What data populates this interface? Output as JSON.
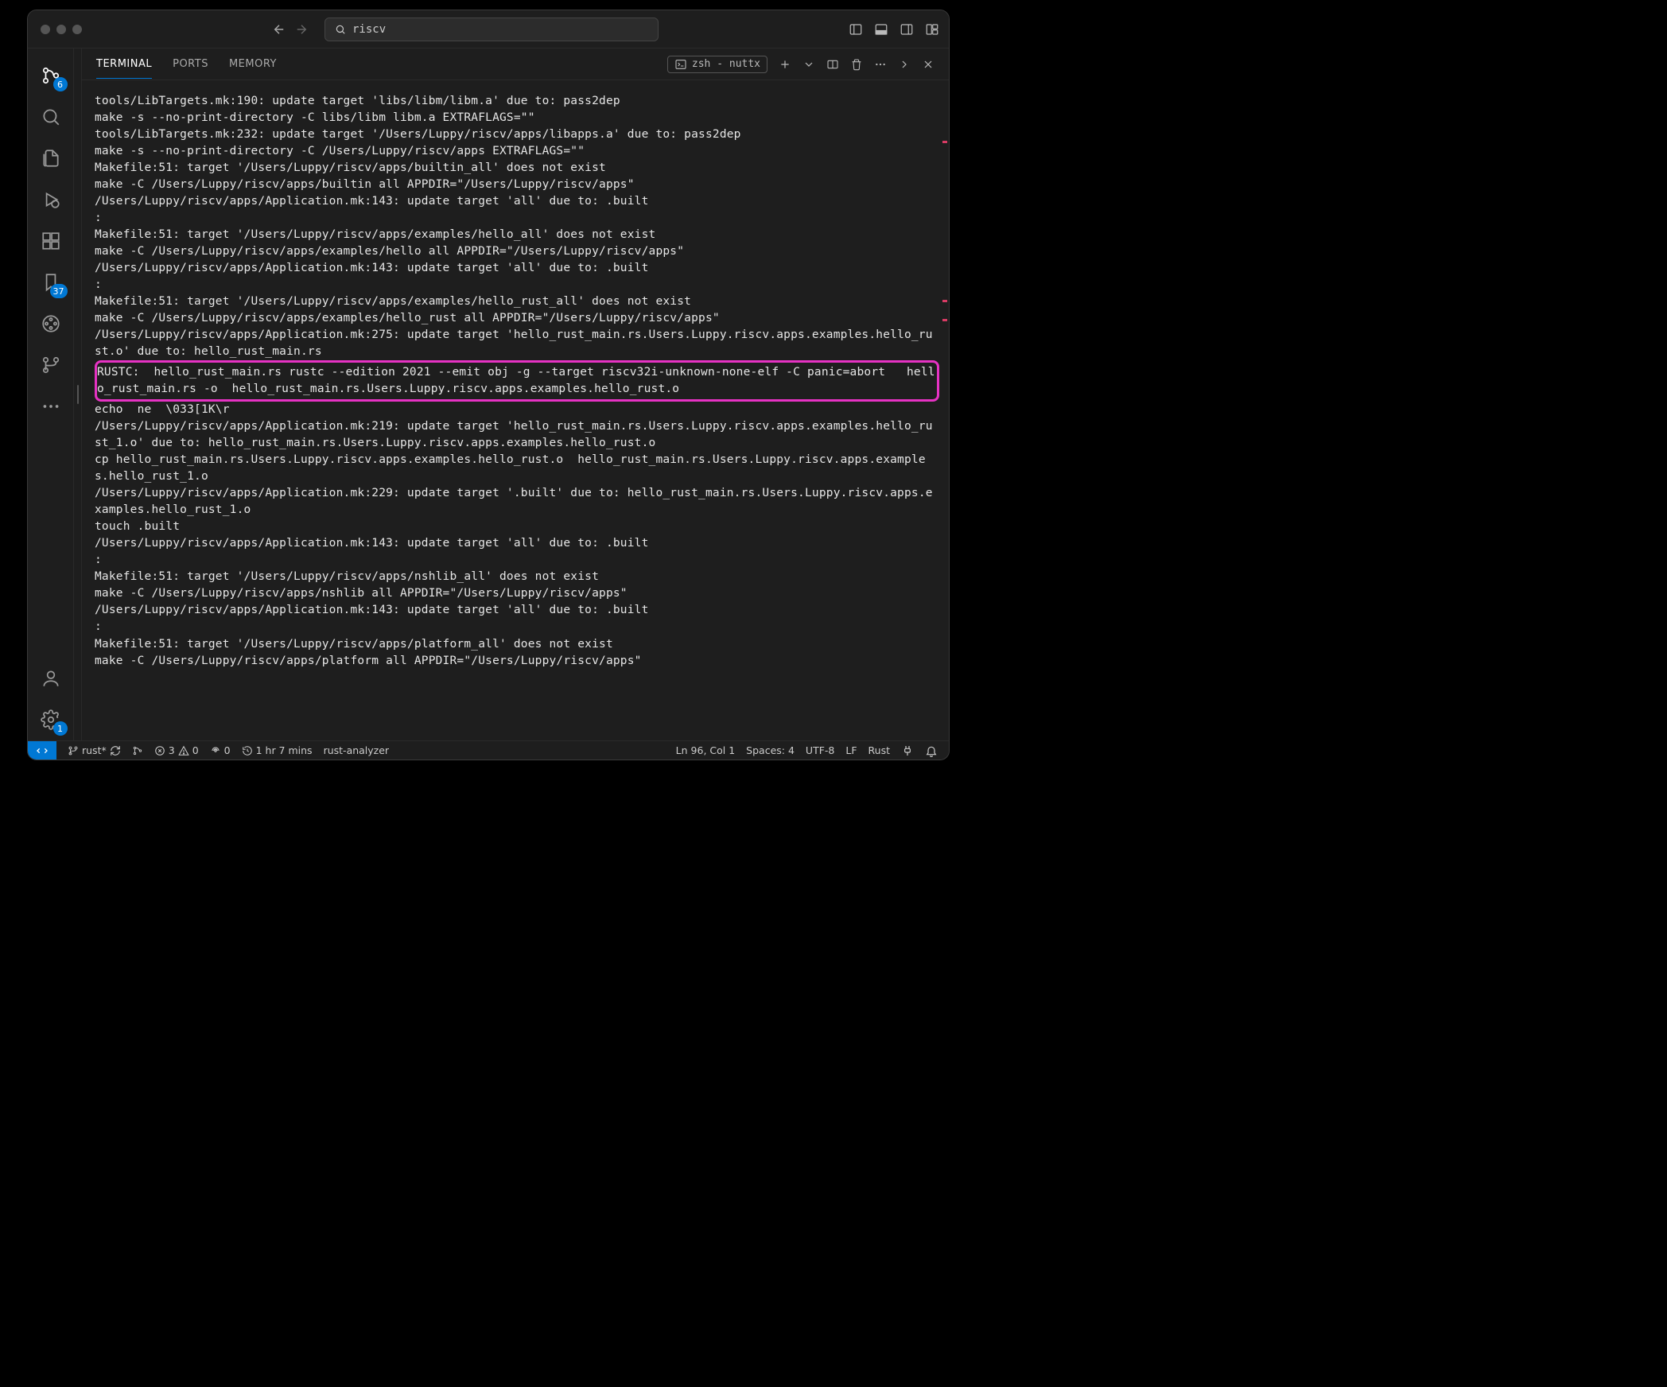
{
  "search": {
    "value": "riscv"
  },
  "activitybar": {
    "scm_badge": "6",
    "files_badge": "37",
    "gear_badge": "1"
  },
  "panel": {
    "tabs": {
      "terminal": "TERMINAL",
      "ports": "PORTS",
      "memory": "MEMORY"
    },
    "term_label": "zsh - nuttx"
  },
  "terminal": {
    "lines_top": [
      "tools/LibTargets.mk:190: update target 'libs/libm/libm.a' due to: pass2dep",
      "make -s --no-print-directory -C libs/libm libm.a EXTRAFLAGS=\"\"",
      "tools/LibTargets.mk:232: update target '/Users/Luppy/riscv/apps/libapps.a' due to: pass2dep",
      "make -s --no-print-directory -C /Users/Luppy/riscv/apps EXTRAFLAGS=\"\"",
      "Makefile:51: target '/Users/Luppy/riscv/apps/builtin_all' does not exist",
      "make -C /Users/Luppy/riscv/apps/builtin all APPDIR=\"/Users/Luppy/riscv/apps\"",
      "/Users/Luppy/riscv/apps/Application.mk:143: update target 'all' due to: .built",
      ":",
      "Makefile:51: target '/Users/Luppy/riscv/apps/examples/hello_all' does not exist",
      "make -C /Users/Luppy/riscv/apps/examples/hello all APPDIR=\"/Users/Luppy/riscv/apps\"",
      "/Users/Luppy/riscv/apps/Application.mk:143: update target 'all' due to: .built",
      ":",
      "Makefile:51: target '/Users/Luppy/riscv/apps/examples/hello_rust_all' does not exist",
      "make -C /Users/Luppy/riscv/apps/examples/hello_rust all APPDIR=\"/Users/Luppy/riscv/apps\"",
      "/Users/Luppy/riscv/apps/Application.mk:275: update target 'hello_rust_main.rs.Users.Luppy.riscv.apps.examples.hello_rust.o' due to: hello_rust_main.rs"
    ],
    "highlight": "RUSTC:  hello_rust_main.rs rustc --edition 2021 --emit obj -g --target riscv32i-unknown-none-elf -C panic=abort   hello_rust_main.rs -o  hello_rust_main.rs.Users.Luppy.riscv.apps.examples.hello_rust.o",
    "lines_bottom": [
      "echo  ne  \\033[1K\\r",
      "/Users/Luppy/riscv/apps/Application.mk:219: update target 'hello_rust_main.rs.Users.Luppy.riscv.apps.examples.hello_rust_1.o' due to: hello_rust_main.rs.Users.Luppy.riscv.apps.examples.hello_rust.o",
      "cp hello_rust_main.rs.Users.Luppy.riscv.apps.examples.hello_rust.o  hello_rust_main.rs.Users.Luppy.riscv.apps.examples.hello_rust_1.o",
      "/Users/Luppy/riscv/apps/Application.mk:229: update target '.built' due to: hello_rust_main.rs.Users.Luppy.riscv.apps.examples.hello_rust_1.o",
      "touch .built",
      "/Users/Luppy/riscv/apps/Application.mk:143: update target 'all' due to: .built",
      ":",
      "Makefile:51: target '/Users/Luppy/riscv/apps/nshlib_all' does not exist",
      "make -C /Users/Luppy/riscv/apps/nshlib all APPDIR=\"/Users/Luppy/riscv/apps\"",
      "/Users/Luppy/riscv/apps/Application.mk:143: update target 'all' due to: .built",
      ":",
      "Makefile:51: target '/Users/Luppy/riscv/apps/platform_all' does not exist",
      "make -C /Users/Luppy/riscv/apps/platform all APPDIR=\"/Users/Luppy/riscv/apps\""
    ]
  },
  "statusbar": {
    "branch": "rust*",
    "errors": "3",
    "warnings": "0",
    "radio": "0",
    "time": "1 hr 7 mins",
    "analyzer": "rust-analyzer",
    "pos": "Ln 96, Col 1",
    "spaces": "Spaces: 4",
    "encoding": "UTF-8",
    "eol": "LF",
    "lang": "Rust"
  }
}
